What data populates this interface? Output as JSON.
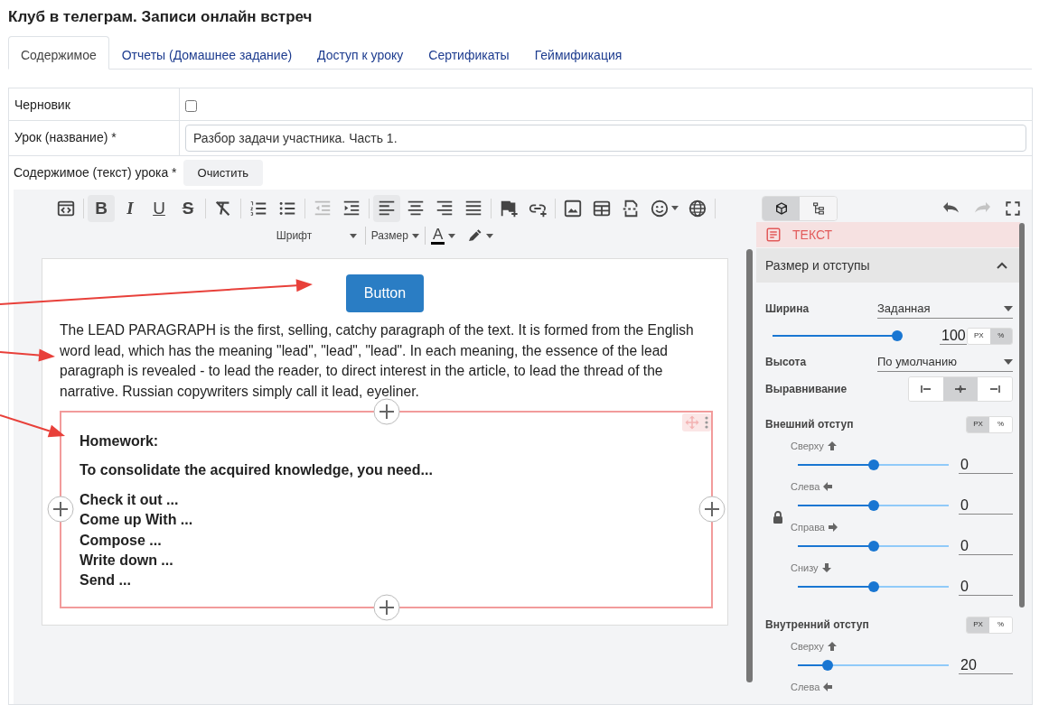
{
  "page_title": "Клуб в телеграм. Записи онлайн встреч",
  "tabs": [
    {
      "label": "Содержимое",
      "selected": true
    },
    {
      "label": "Отчеты (Домашнее задание)",
      "selected": false
    },
    {
      "label": "Доступ к уроку",
      "selected": false
    },
    {
      "label": "Сертификаты",
      "selected": false
    },
    {
      "label": "Геймификация",
      "selected": false
    }
  ],
  "form": {
    "draft": {
      "label": "Черновик",
      "checked": false
    },
    "lesson_name": {
      "label": "Урок (название) *",
      "value": "Разбор задачи участника. Часть 1."
    },
    "content": {
      "label": "Содержимое (текст) урока *",
      "clear_button": "Очистить"
    }
  },
  "toolbar": {
    "groups": [
      [
        {
          "kind": "source",
          "active": false,
          "disabled": false
        }
      ],
      [
        {
          "kind": "bold",
          "label": "B",
          "active": true,
          "disabled": false
        },
        {
          "kind": "italic",
          "label": "I",
          "active": false,
          "disabled": false
        },
        {
          "kind": "underline",
          "label": "U",
          "active": false,
          "disabled": false
        },
        {
          "kind": "strike",
          "label": "S",
          "active": false,
          "disabled": false
        }
      ],
      [
        {
          "kind": "clear",
          "active": false,
          "disabled": false
        }
      ],
      [
        {
          "kind": "ordered-list",
          "active": false,
          "disabled": false
        },
        {
          "kind": "bullet-list",
          "active": false,
          "disabled": false
        }
      ],
      [
        {
          "kind": "outdent",
          "active": false,
          "disabled": true
        },
        {
          "kind": "indent",
          "active": false,
          "disabled": false
        }
      ],
      [
        {
          "kind": "align-left",
          "active": true,
          "disabled": false
        },
        {
          "kind": "align-center",
          "active": false,
          "disabled": false
        },
        {
          "kind": "align-right",
          "active": false,
          "disabled": false
        },
        {
          "kind": "justify",
          "active": false,
          "disabled": false
        }
      ],
      [
        {
          "kind": "flag",
          "active": false,
          "disabled": false
        },
        {
          "kind": "link",
          "active": false,
          "disabled": false
        }
      ],
      [
        {
          "kind": "image",
          "active": false,
          "disabled": false
        },
        {
          "kind": "table",
          "active": false,
          "disabled": false
        },
        {
          "kind": "page-break",
          "active": false,
          "disabled": false
        },
        {
          "kind": "emoji",
          "active": false,
          "disabled": false
        },
        {
          "kind": "globe",
          "active": false,
          "disabled": false
        }
      ]
    ],
    "font_dropdown": "Шрифт",
    "size_dropdown": "Размер",
    "text_color_label": "A"
  },
  "view_modes": [
    {
      "kind": "style",
      "selected": true
    },
    {
      "kind": "layers",
      "selected": false
    }
  ],
  "history": {
    "undo_disabled": false,
    "redo_disabled": true
  },
  "editor_content": {
    "button_label": "Button",
    "paragraph": "The LEAD PARAGRAPH is the first, selling, catchy paragraph of the text. It is formed from the English word lead, which has the meaning \"lead\", \"lead\", \"lead\". In each meaning, the essence of the lead paragraph is revealed - to lead the reader, to direct interest in the article, to lead the thread of the narrative. Russian copywriters simply call it lead, eyeliner.",
    "homework": {
      "title": "Homework:",
      "intro": "To consolidate the acquired knowledge, you need...",
      "items": [
        "Check it out ...",
        "Come up With ...",
        "Compose ...",
        "Write down ...",
        "Send ..."
      ]
    }
  },
  "panel": {
    "element_label": "ТЕКСТ",
    "section": {
      "title": "Размер и отступы",
      "expanded": true
    },
    "width": {
      "label": "Ширина",
      "mode": "Заданная",
      "level": 1,
      "value": "100",
      "units": [
        {
          "label": "PX",
          "selected": false
        },
        {
          "label": "%",
          "selected": true
        }
      ]
    },
    "height": {
      "label": "Высота",
      "mode": "По умолчанию"
    },
    "alignment": {
      "label": "Выравнивание",
      "options": [
        {
          "kind": "left",
          "selected": false
        },
        {
          "kind": "center",
          "selected": true
        },
        {
          "kind": "right",
          "selected": false
        }
      ]
    },
    "margin": {
      "label": "Внешний отступ",
      "locked": true,
      "units": [
        {
          "label": "PX",
          "selected": true
        },
        {
          "label": "%",
          "selected": false
        }
      ],
      "sides": [
        {
          "kind": "top",
          "label": "Сверху",
          "level": 0.5,
          "value": "0"
        },
        {
          "kind": "left",
          "label": "Слева",
          "level": 0.5,
          "value": "0"
        },
        {
          "kind": "right",
          "label": "Справа",
          "level": 0.5,
          "value": "0"
        },
        {
          "kind": "bottom",
          "label": "Снизу",
          "level": 0.5,
          "value": "0"
        }
      ]
    },
    "padding": {
      "label": "Внутренний отступ",
      "units": [
        {
          "label": "PX",
          "selected": true
        },
        {
          "label": "%",
          "selected": false
        }
      ],
      "sides": [
        {
          "kind": "top",
          "label": "Сверху",
          "level": 0.2,
          "value": "20"
        },
        {
          "kind": "left",
          "label": "Слева"
        }
      ]
    }
  }
}
